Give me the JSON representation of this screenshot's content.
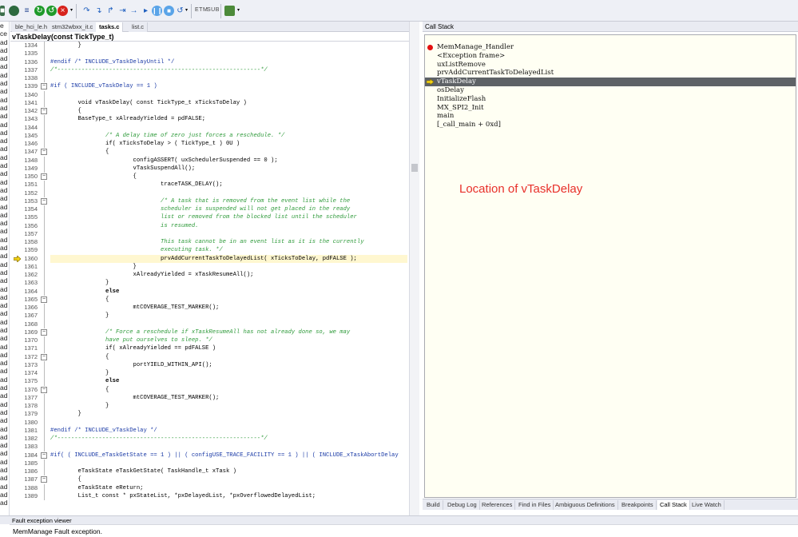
{
  "toolbar": {
    "buttons": [
      "stop-icon",
      "list-icon",
      "reset-icon",
      "go-icon",
      "halt-icon",
      "step-over-icon",
      "step-into-icon",
      "step-out-icon",
      "run-to-cursor-icon",
      "play-icon",
      "pause-icon",
      "restart-icon"
    ],
    "labels": [
      "ETM",
      "SUB"
    ]
  },
  "left_gutter": {
    "items": [
      "e",
      "ce",
      "ad",
      "ad",
      "ad",
      "ad",
      "ad",
      "ad",
      "ad",
      "ad",
      "ad",
      "ad",
      "ad",
      "ad",
      "ad",
      "ad",
      "ad",
      "ad",
      "ad",
      "ad",
      "ad",
      "ad",
      "ad",
      "ad",
      "ad",
      "ad",
      "ad",
      "ad",
      "ad",
      "ad",
      "ad",
      "ad",
      "ad",
      "ad",
      "ad",
      "ad",
      "ad",
      "ad",
      "ad",
      "ad",
      "ad",
      "ad",
      "ad",
      "ad",
      "ad",
      "ad",
      "ad",
      "ad",
      "ad",
      "ad",
      "ad",
      "ad",
      "ad",
      "ad",
      "ad",
      "ad",
      "ad",
      "ad",
      "ad"
    ]
  },
  "editor": {
    "tabs": [
      "ble_hci_le.h",
      "stm32wbxx_it.c",
      "tasks.c",
      "list.c"
    ],
    "active_tab": "tasks.c",
    "function_name": "vTaskDelay(const TickType_t)",
    "function_icon": "f()",
    "lines": [
      {
        "n": "1334",
        "t": "        }",
        "s": ""
      },
      {
        "n": "1335",
        "t": "",
        "s": ""
      },
      {
        "n": "1336",
        "t": "#endif /* INCLUDE_vTaskDelayUntil */",
        "s": "pp"
      },
      {
        "n": "1337",
        "t": "/*-----------------------------------------------------------*/",
        "s": "cm"
      },
      {
        "n": "1338",
        "t": "",
        "s": ""
      },
      {
        "n": "1339",
        "t": "#if ( INCLUDE_vTaskDelay == 1 )",
        "s": "pp",
        "fold": true
      },
      {
        "n": "1340",
        "t": "",
        "s": ""
      },
      {
        "n": "1341",
        "t": "        void vTaskDelay( const TickType_t xTicksToDelay )",
        "s": ""
      },
      {
        "n": "1342",
        "t": "        {",
        "s": "",
        "fold": true
      },
      {
        "n": "1343",
        "t": "        BaseType_t xAlreadyYielded = pdFALSE;",
        "s": ""
      },
      {
        "n": "1344",
        "t": "",
        "s": ""
      },
      {
        "n": "1345",
        "t": "                /* A delay time of zero just forces a reschedule. */",
        "s": "cm"
      },
      {
        "n": "1346",
        "t": "                if( xTicksToDelay > ( TickType_t ) 0U )",
        "s": ""
      },
      {
        "n": "1347",
        "t": "                {",
        "s": "",
        "fold": true
      },
      {
        "n": "1348",
        "t": "                        configASSERT( uxSchedulerSuspended == 0 );",
        "s": ""
      },
      {
        "n": "1349",
        "t": "                        vTaskSuspendAll();",
        "s": ""
      },
      {
        "n": "1350",
        "t": "                        {",
        "s": "",
        "fold": true
      },
      {
        "n": "1351",
        "t": "                                traceTASK_DELAY();",
        "s": ""
      },
      {
        "n": "1352",
        "t": "",
        "s": ""
      },
      {
        "n": "1353",
        "t": "                                /* A task that is removed from the event list while the",
        "s": "cm",
        "fold": true
      },
      {
        "n": "1354",
        "t": "                                scheduler is suspended will not get placed in the ready",
        "s": "cm"
      },
      {
        "n": "1355",
        "t": "                                list or removed from the blocked list until the scheduler",
        "s": "cm"
      },
      {
        "n": "1356",
        "t": "                                is resumed.",
        "s": "cm"
      },
      {
        "n": "1357",
        "t": "",
        "s": ""
      },
      {
        "n": "1358",
        "t": "                                This task cannot be in an event list as it is the currently",
        "s": "cm"
      },
      {
        "n": "1359",
        "t": "                                executing task. */",
        "s": "cm"
      },
      {
        "n": "1360",
        "t": "                                prvAddCurrentTaskToDelayedList( xTicksToDelay, pdFALSE );",
        "s": "hlt",
        "exec": true
      },
      {
        "n": "1361",
        "t": "                        }",
        "s": ""
      },
      {
        "n": "1362",
        "t": "                        xAlreadyYielded = xTaskResumeAll();",
        "s": ""
      },
      {
        "n": "1363",
        "t": "                }",
        "s": ""
      },
      {
        "n": "1364",
        "t": "                else",
        "s": "kw"
      },
      {
        "n": "1365",
        "t": "                {",
        "s": "",
        "fold": true
      },
      {
        "n": "1366",
        "t": "                        mtCOVERAGE_TEST_MARKER();",
        "s": ""
      },
      {
        "n": "1367",
        "t": "                }",
        "s": ""
      },
      {
        "n": "1368",
        "t": "",
        "s": ""
      },
      {
        "n": "1369",
        "t": "                /* Force a reschedule if xTaskResumeAll has not already done so, we may",
        "s": "cm",
        "fold": true
      },
      {
        "n": "1370",
        "t": "                have put ourselves to sleep. */",
        "s": "cm"
      },
      {
        "n": "1371",
        "t": "                if( xAlreadyYielded == pdFALSE )",
        "s": ""
      },
      {
        "n": "1372",
        "t": "                {",
        "s": "",
        "fold": true
      },
      {
        "n": "1373",
        "t": "                        portYIELD_WITHIN_API();",
        "s": ""
      },
      {
        "n": "1374",
        "t": "                }",
        "s": ""
      },
      {
        "n": "1375",
        "t": "                else",
        "s": "kw"
      },
      {
        "n": "1376",
        "t": "                {",
        "s": "",
        "fold": true
      },
      {
        "n": "1377",
        "t": "                        mtCOVERAGE_TEST_MARKER();",
        "s": ""
      },
      {
        "n": "1378",
        "t": "                }",
        "s": ""
      },
      {
        "n": "1379",
        "t": "        }",
        "s": ""
      },
      {
        "n": "1380",
        "t": "",
        "s": ""
      },
      {
        "n": "1381",
        "t": "#endif /* INCLUDE_vTaskDelay */",
        "s": "pp"
      },
      {
        "n": "1382",
        "t": "/*-----------------------------------------------------------*/",
        "s": "cm"
      },
      {
        "n": "1383",
        "t": "",
        "s": ""
      },
      {
        "n": "1384",
        "t": "#if( ( INCLUDE_eTaskGetState == 1 ) || ( configUSE_TRACE_FACILITY == 1 ) || ( INCLUDE_xTaskAbortDelay",
        "s": "pp",
        "fold": true
      },
      {
        "n": "1385",
        "t": "",
        "s": ""
      },
      {
        "n": "1386",
        "t": "        eTaskState eTaskGetState( TaskHandle_t xTask )",
        "s": ""
      },
      {
        "n": "1387",
        "t": "        {",
        "s": "",
        "fold": true
      },
      {
        "n": "1388",
        "t": "        eTaskState eReturn;",
        "s": ""
      },
      {
        "n": "1389",
        "t": "        List_t const * pxStateList, *pxDelayedList, *pxOverflowedDelayedList;",
        "s": ""
      }
    ]
  },
  "call_stack": {
    "title": "Call Stack",
    "frames": [
      {
        "label": "MemManage_Handler",
        "marker": "breakpoint-dot-icon"
      },
      {
        "label": "<Exception frame>",
        "marker": ""
      },
      {
        "label": "uxListRemove",
        "marker": ""
      },
      {
        "label": "prvAddCurrentTaskToDelayedList",
        "marker": ""
      },
      {
        "label": "vTaskDelay",
        "marker": "current-frame-arrow-icon",
        "selected": true
      },
      {
        "label": "osDelay",
        "marker": ""
      },
      {
        "label": "InitializeFlash",
        "marker": ""
      },
      {
        "label": "MX_SPI2_Init",
        "marker": ""
      },
      {
        "label": "main",
        "marker": ""
      },
      {
        "label": "[_call_main + 0xd]",
        "marker": ""
      }
    ],
    "annotation": "Location of vTaskDelay",
    "annotation_color": "#e8302a"
  },
  "bottom_tabs": {
    "items": [
      "Build",
      "Debug Log",
      "References",
      "Find in Files",
      "Ambiguous Definitions",
      "Breakpoints",
      "Call Stack",
      "Live Watch"
    ],
    "active": "Call Stack"
  },
  "fault_viewer": {
    "title": "Fault exception viewer",
    "message": "MemManage Fault exception."
  },
  "colors": {
    "highlight": "#ffef4a",
    "comment": "#2e9a3a",
    "preprocessor": "#1a3aa6",
    "selection": "#5e6266",
    "breakpoint": "#e41010"
  }
}
